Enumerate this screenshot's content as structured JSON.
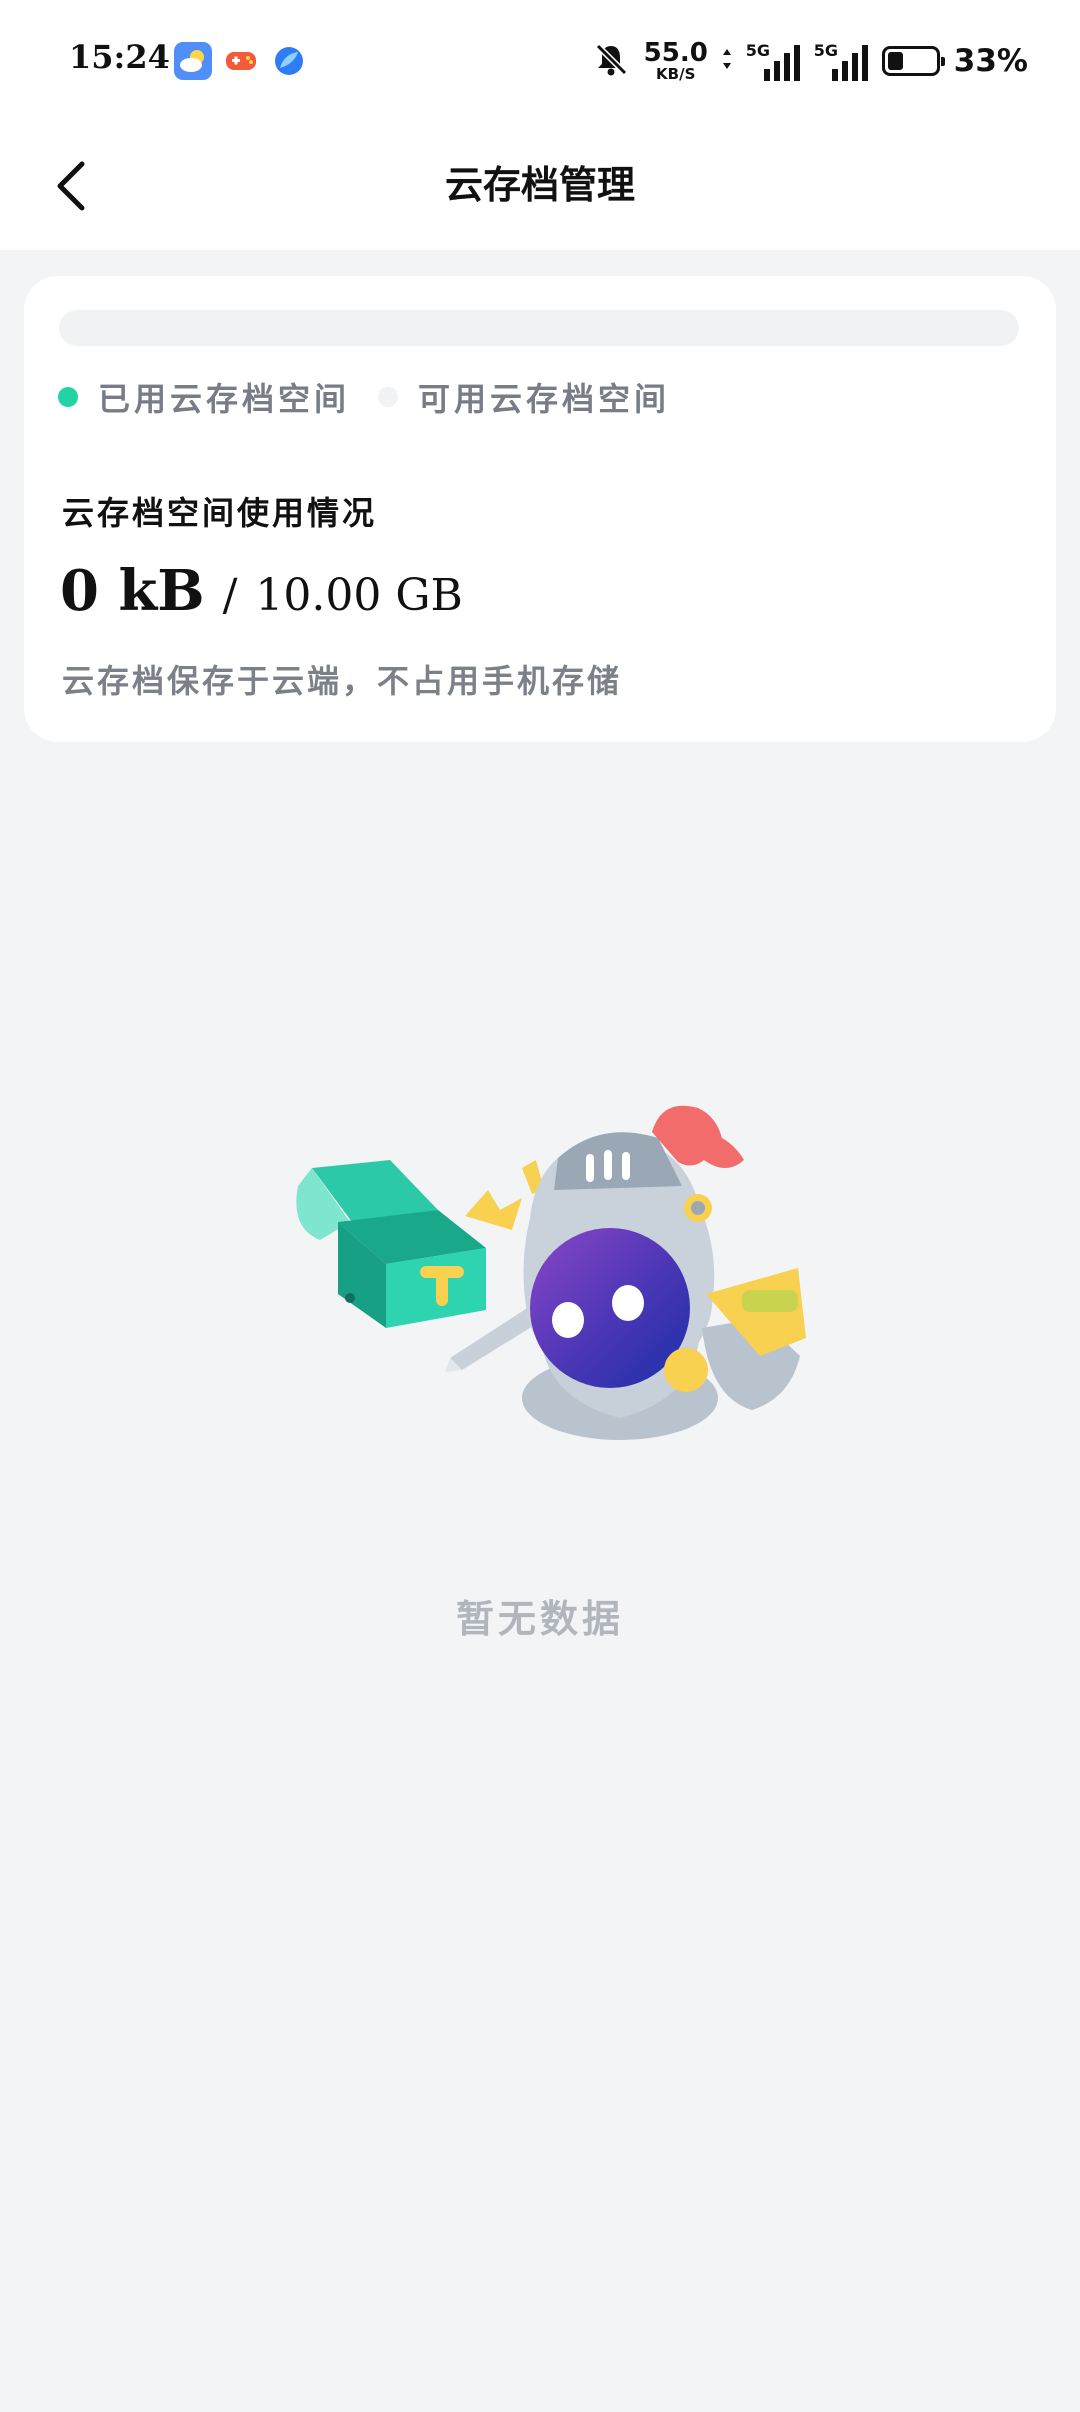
{
  "status_bar": {
    "time": "15:24",
    "network_speed_value": "55.0",
    "network_speed_unit": "KB/S",
    "signal_1_label": "5G",
    "signal_2_label": "5G",
    "battery_percent": "33%",
    "battery_level": 0.33,
    "icons": [
      "weather-app-icon",
      "game-center-icon",
      "browser-icon",
      "mute-bell-icon"
    ]
  },
  "header": {
    "title": "云存档管理",
    "back_icon": "chevron-left-icon"
  },
  "storage_card": {
    "usage_fraction": 0,
    "legend_used_label": "已用云存档空间",
    "legend_available_label": "可用云存档空间",
    "section_title": "云存档空间使用情况",
    "used_value": "0 kB",
    "separator": "/",
    "total_value": "10.00 GB",
    "note": "云存档保存于云端，不占用手机存储"
  },
  "empty_state": {
    "illustration": "knight-with-treasure-chest",
    "text": "暂无数据"
  },
  "colors": {
    "used": "#22d3a3",
    "available": "#f1f2f4",
    "background": "#f3f4f6",
    "card": "#ffffff"
  }
}
